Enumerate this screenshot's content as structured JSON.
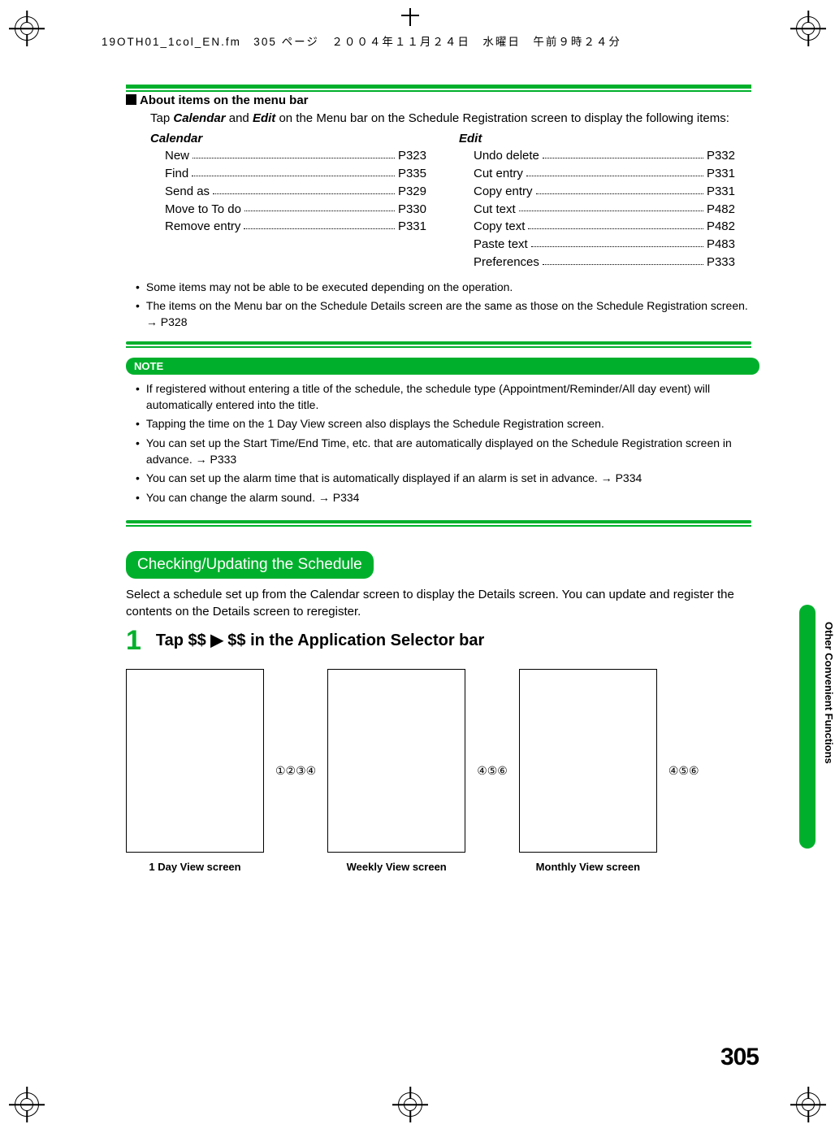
{
  "header_line": "19OTH01_1col_EN.fm　305 ページ　２００４年１１月２４日　水曜日　午前９時２４分",
  "about": {
    "title": "About items on the menu bar",
    "intro_pre": "Tap ",
    "intro_em1": "Calendar",
    "intro_mid": " and ",
    "intro_em2": "Edit",
    "intro_post": " on the Menu bar on the Schedule Registration screen to display the following items:"
  },
  "menu": {
    "calendar": {
      "title": "Calendar",
      "items": [
        {
          "label": "New",
          "page": "P323"
        },
        {
          "label": "Find",
          "page": "P335"
        },
        {
          "label": "Send as",
          "page": "P329"
        },
        {
          "label": "Move to To do",
          "page": "P330"
        },
        {
          "label": "Remove entry",
          "page": "P331"
        }
      ]
    },
    "edit": {
      "title": "Edit",
      "items": [
        {
          "label": "Undo delete",
          "page": "P332"
        },
        {
          "label": "Cut entry",
          "page": "P331"
        },
        {
          "label": "Copy entry",
          "page": "P331"
        },
        {
          "label": "Cut text",
          "page": "P482"
        },
        {
          "label": "Copy text",
          "page": "P482"
        },
        {
          "label": "Paste text",
          "page": "P483"
        },
        {
          "label": "Preferences",
          "page": "P333"
        }
      ]
    }
  },
  "notes_above": [
    "Some items may not be able to be executed depending on the operation.",
    "The items on the Menu bar on the Schedule Details screen are the same as those on the Schedule Registration screen. → P328"
  ],
  "note_label": "NOTE",
  "notes_box": [
    "If registered without entering a title of the schedule, the schedule type (Appointment/Reminder/All day event) will automatically entered into the title.",
    "Tapping the time on the 1 Day View screen also displays the Schedule Registration screen.",
    "You can set up the Start Time/End Time, etc. that are automatically displayed on the Schedule Registration screen in advance. → P333",
    "You can set up the alarm time that is automatically displayed if an alarm is set in advance. → P334",
    "You can change the alarm sound. → P334"
  ],
  "section": {
    "title": "Checking/Updating the Schedule",
    "desc": "Select a schedule set up from the Calendar screen to display the Details screen. You can update and register the contents on the Details screen to reregister."
  },
  "step": {
    "num": "1",
    "title": "Tap $$ ▶ $$ in the Application Selector bar"
  },
  "screens": {
    "annot1": "①②③④",
    "annot2": "④⑤⑥",
    "annot3": "④⑤⑥",
    "label1": "1 Day View screen",
    "label2": "Weekly View screen",
    "label3": "Monthly View screen"
  },
  "side_tab": "Other Convenient Functions",
  "page_number": "305"
}
